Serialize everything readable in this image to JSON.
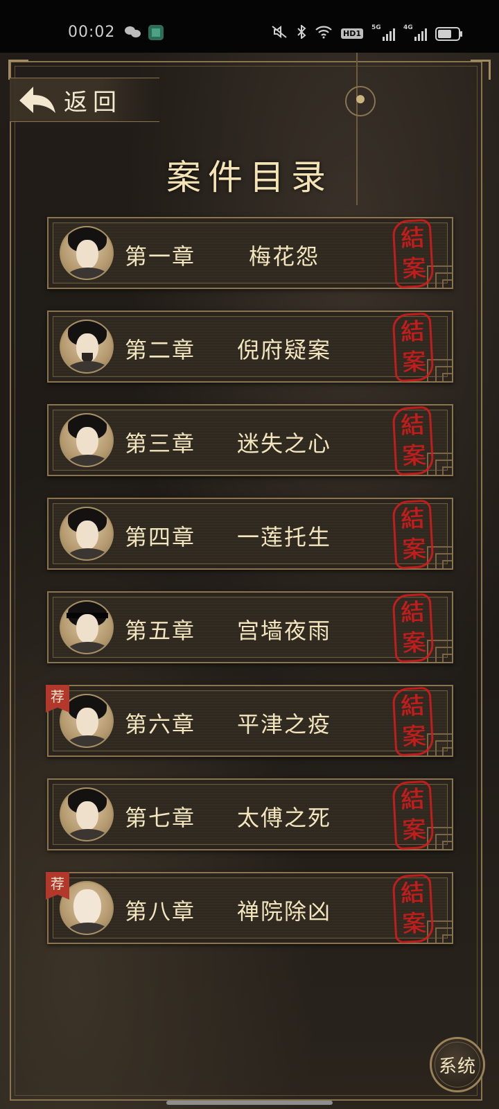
{
  "status_bar": {
    "time": "00:02",
    "hd_label": "HD1",
    "signal_1_label": "5G",
    "signal_2_label": "4G",
    "battery_level": 0.7
  },
  "header": {
    "back_label": "返回",
    "title": "案件目录"
  },
  "chapters": [
    {
      "number": "第一章",
      "title": "梅花怨",
      "status": "結案",
      "recommended": false
    },
    {
      "number": "第二章",
      "title": "倪府疑案",
      "status": "結案",
      "recommended": false
    },
    {
      "number": "第三章",
      "title": "迷失之心",
      "status": "結案",
      "recommended": false
    },
    {
      "number": "第四章",
      "title": "一莲托生",
      "status": "結案",
      "recommended": false
    },
    {
      "number": "第五章",
      "title": "宫墙夜雨",
      "status": "結案",
      "recommended": false
    },
    {
      "number": "第六章",
      "title": "平津之疫",
      "status": "結案",
      "recommended": true,
      "badge": "荐"
    },
    {
      "number": "第七章",
      "title": "太傅之死",
      "status": "結案",
      "recommended": false
    },
    {
      "number": "第八章",
      "title": "禅院除凶",
      "status": "結案",
      "recommended": true,
      "badge": "荐"
    }
  ],
  "system_button": {
    "label": "系统"
  },
  "icons": {
    "back": "back-arrow-icon",
    "wechat": "wechat-icon",
    "mute": "mute-icon",
    "bluetooth": "bluetooth-icon",
    "wifi": "wifi-icon"
  },
  "colors": {
    "background": "#1e1a16",
    "gold_border": "#8a7550",
    "text": "#f3e5bd",
    "seal_red": "#d21c1c",
    "badge_red": "#b3382c"
  }
}
